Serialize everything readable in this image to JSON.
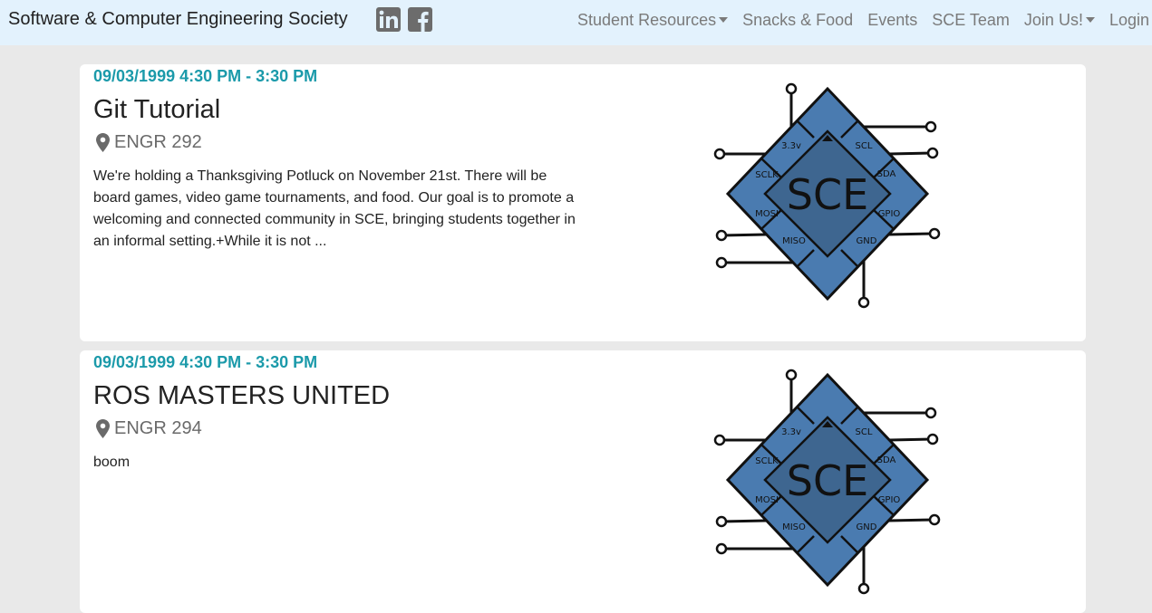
{
  "navbar": {
    "brand": "Software & Computer Engineering Society",
    "social": [
      {
        "icon": "linkedin-icon"
      },
      {
        "icon": "facebook-icon"
      }
    ],
    "links": [
      {
        "label": "Student Resources",
        "dropdown": true
      },
      {
        "label": "Snacks & Food",
        "dropdown": false
      },
      {
        "label": "Events",
        "dropdown": false
      },
      {
        "label": "SCE Team",
        "dropdown": false
      },
      {
        "label": "Join Us!",
        "dropdown": true
      },
      {
        "label": "Login",
        "dropdown": false
      }
    ]
  },
  "events": [
    {
      "date": "09/03/1999 4:30 PM - 3:30 PM",
      "title": "Git Tutorial",
      "location": "ENGR 292",
      "description": "We're holding a Thanksgiving Potluck on November 21st. There will be board games, video game tournaments, and food. Our goal is to promote a welcoming and connected community in SCE, bringing students together in an informal setting.+While it is not ..."
    },
    {
      "date": "09/03/1999 4:30 PM - 3:30 PM",
      "title": "ROS MASTERS UNITED",
      "location": "ENGR 294",
      "description": "boom"
    }
  ],
  "logo": {
    "center": "SCE",
    "pins": [
      "3.3v",
      "SCL",
      "SCLK",
      "SDA",
      "MOSI",
      "GPIO",
      "MISO",
      "GND"
    ],
    "colors": {
      "outer": "#4a7bb0",
      "inner": "#3e6690",
      "outline": "#111111"
    }
  },
  "theme": {
    "navbar_bg": "#e3f2fd",
    "date_color": "#1b9aaa",
    "page_bg": "#e9e9e9"
  }
}
